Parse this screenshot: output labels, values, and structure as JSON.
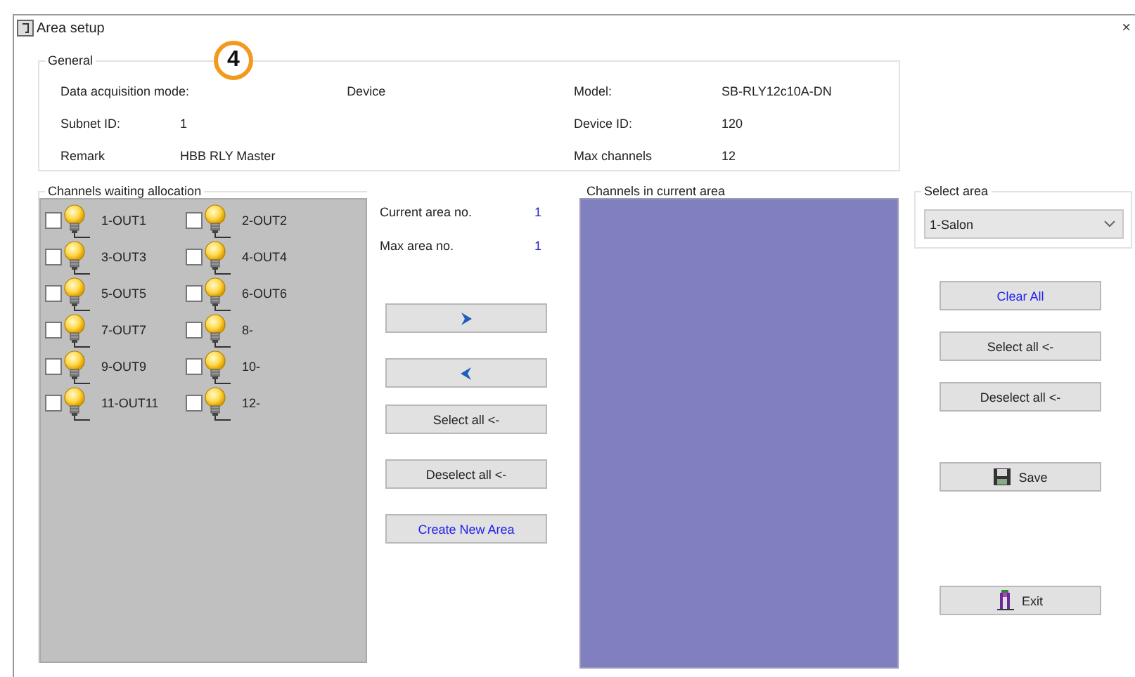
{
  "window": {
    "title": "Area setup",
    "close": "×"
  },
  "annotation_badge": "4",
  "general": {
    "title": "General",
    "left_fields": [
      {
        "label": "Data acquisition mode:",
        "value": "Device"
      },
      {
        "label": "Subnet ID:",
        "value": "1"
      },
      {
        "label": "Remark",
        "value": "HBB RLY Master"
      }
    ],
    "right_fields": [
      {
        "label": "Model:",
        "value": "SB-RLY12c10A-DN"
      },
      {
        "label": "Device ID:",
        "value": "120"
      },
      {
        "label": "Max channels",
        "value": "12"
      }
    ]
  },
  "waiting": {
    "title": "Channels waiting allocation",
    "channels": [
      {
        "label": "1-OUT1",
        "checked": false
      },
      {
        "label": "2-OUT2",
        "checked": false
      },
      {
        "label": "3-OUT3",
        "checked": false
      },
      {
        "label": "4-OUT4",
        "checked": false
      },
      {
        "label": "5-OUT5",
        "checked": false
      },
      {
        "label": "6-OUT6",
        "checked": false
      },
      {
        "label": "7-OUT7",
        "checked": false
      },
      {
        "label": "8-",
        "checked": false
      },
      {
        "label": "9-OUT9",
        "checked": false
      },
      {
        "label": "10-",
        "checked": false
      },
      {
        "label": "11-OUT11",
        "checked": false
      },
      {
        "label": "12-",
        "checked": false
      }
    ]
  },
  "area_info": [
    {
      "label": "Current area no.",
      "value": "1"
    },
    {
      "label": "Max area no.",
      "value": "1"
    }
  ],
  "middle_buttons": [
    {
      "kind": "add"
    },
    {
      "kind": "remove"
    },
    {
      "kind": "text",
      "label": "Select all <-",
      "emphasis": false
    },
    {
      "kind": "text",
      "label": "Deselect all <-",
      "emphasis": false
    },
    {
      "kind": "text",
      "label": "Create New Area",
      "emphasis": true
    }
  ],
  "current": {
    "title": "Channels in current area"
  },
  "select_area": {
    "title": "Select area",
    "value": "1-Salon"
  },
  "right_buttons": [
    {
      "kind": "text",
      "label": "Clear All",
      "emphasis": true
    },
    {
      "kind": "text",
      "label": "Select all <-",
      "emphasis": false
    },
    {
      "kind": "text",
      "label": "Deselect all <-",
      "emphasis": false
    },
    {
      "kind": "save",
      "label": "Save",
      "emphasis": false
    },
    {
      "kind": "exit",
      "label": "Exit",
      "emphasis": false
    }
  ]
}
